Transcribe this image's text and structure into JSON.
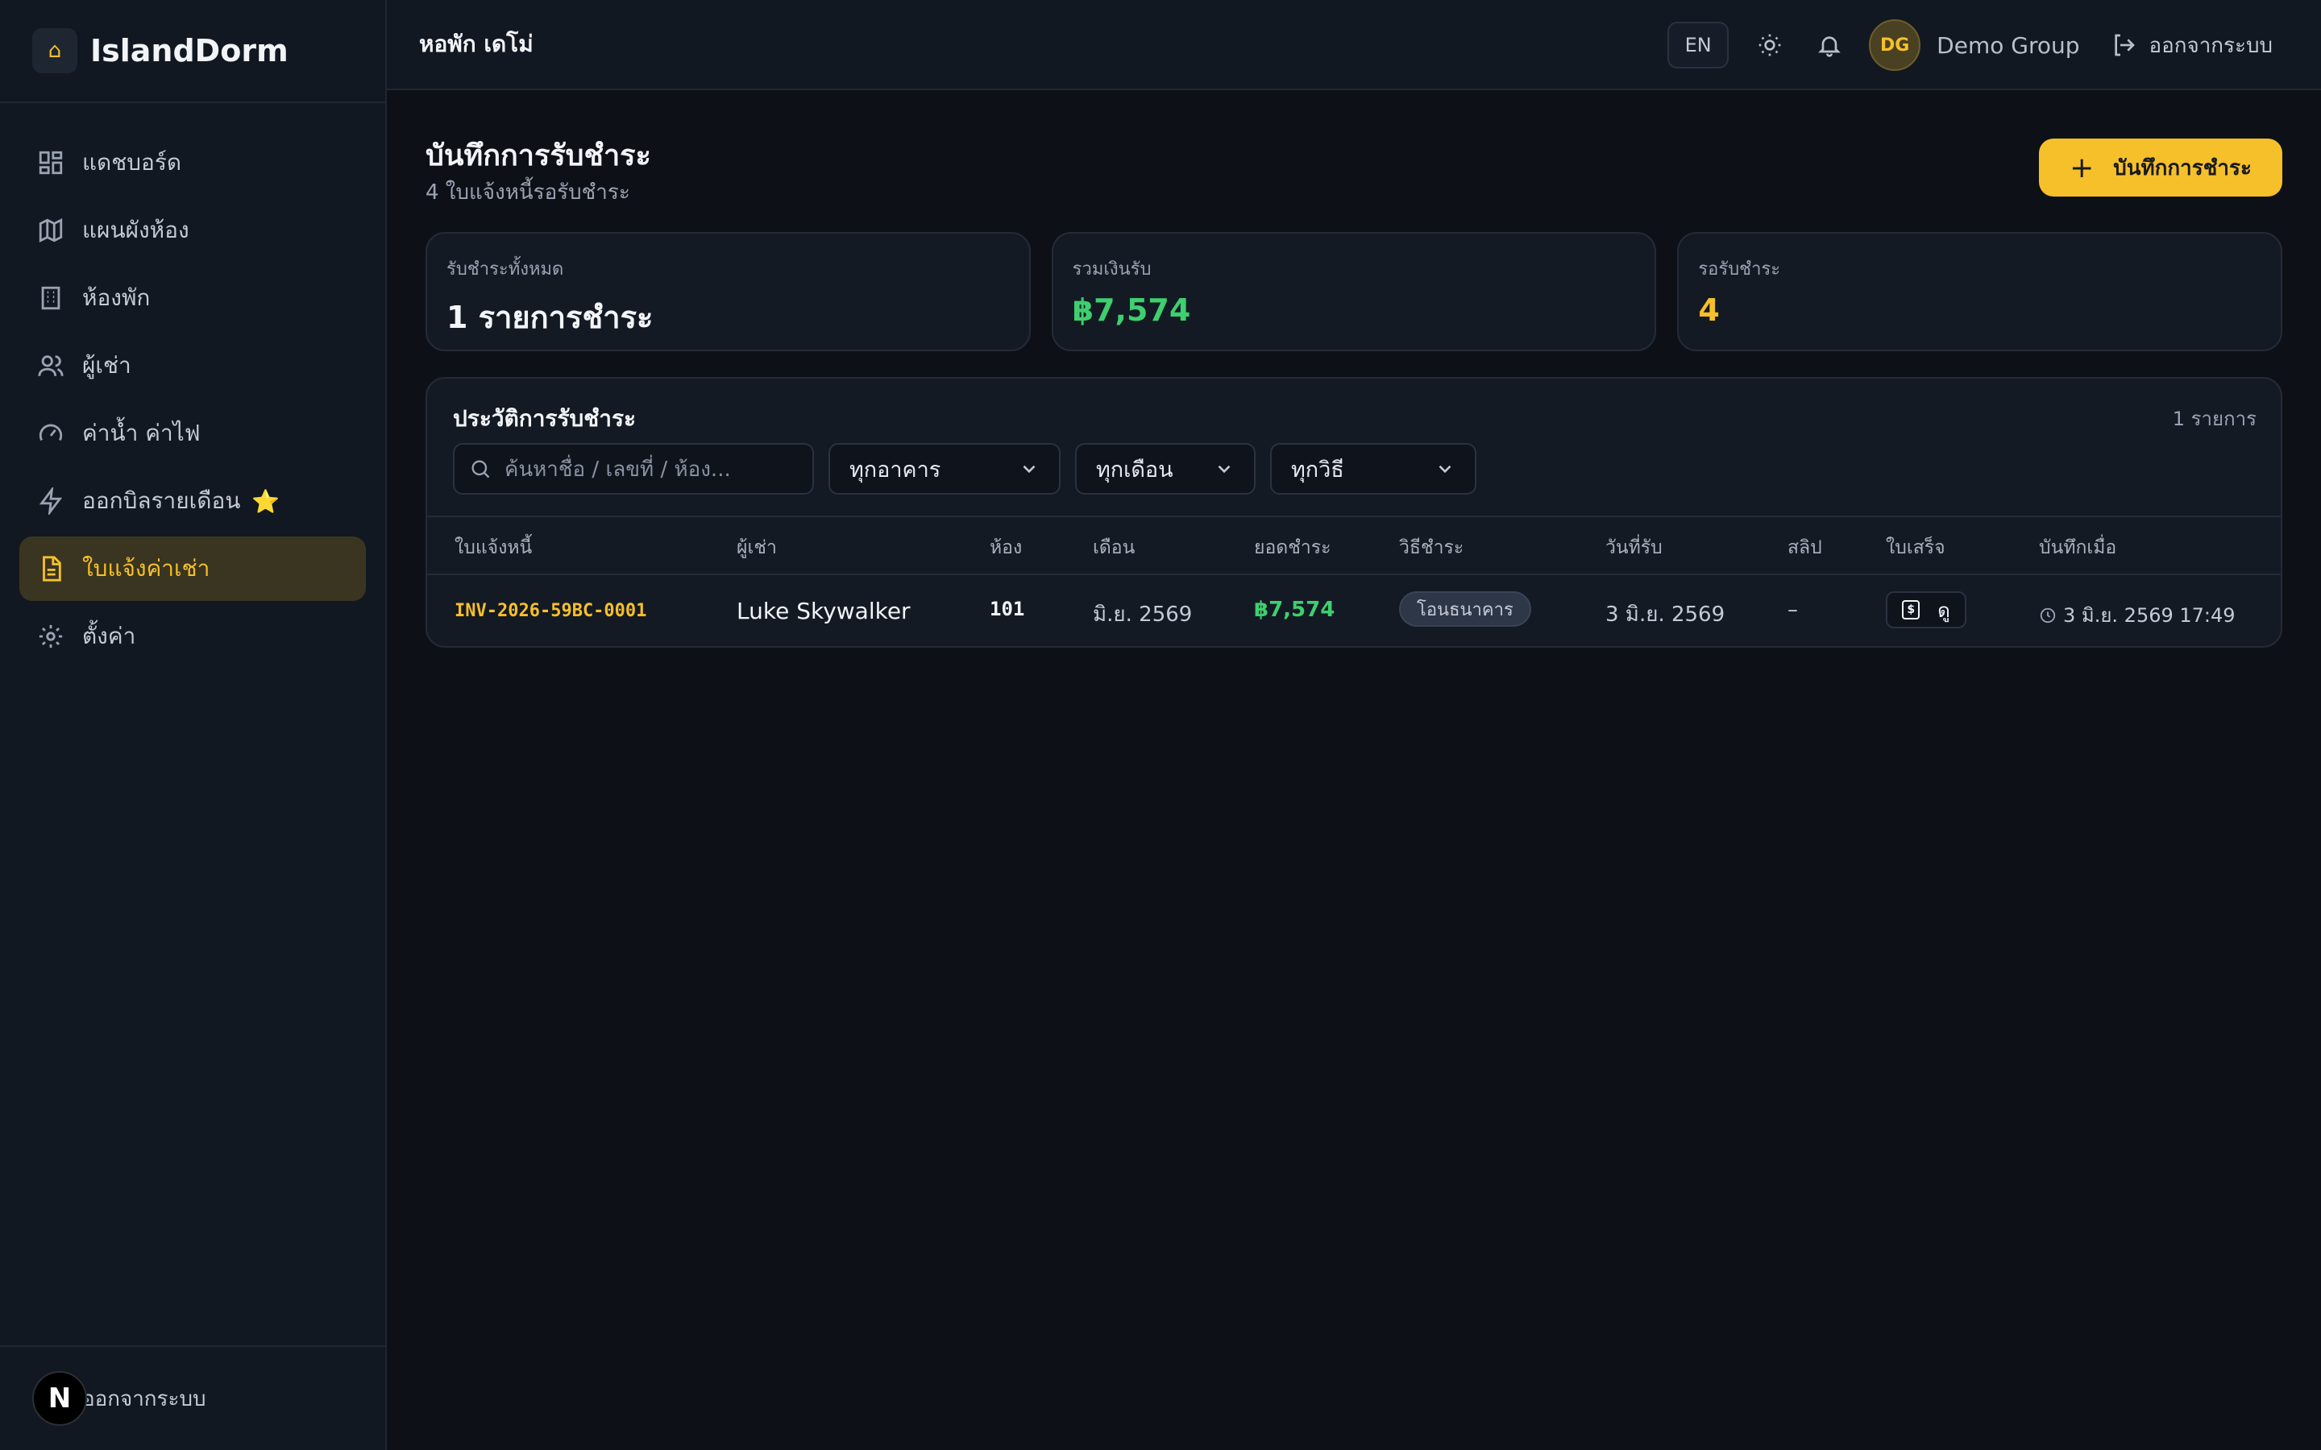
{
  "sidebar": {
    "brand": "IslandDorm",
    "brand_icon": "house-icon",
    "items": [
      {
        "label": "แดชบอร์ด",
        "icon": "dashboard-grid-icon"
      },
      {
        "label": "แผนผังห้อง",
        "icon": "map-icon"
      },
      {
        "label": "ห้องพัก",
        "icon": "building-icon"
      },
      {
        "label": "ผู้เช่า",
        "icon": "users-icon"
      },
      {
        "label": "ค่าน้ำ ค่าไฟ",
        "icon": "gauge-icon"
      },
      {
        "label": "ออกบิลรายเดือน",
        "icon": "lightning-icon",
        "emoji": "⭐"
      },
      {
        "label": "ใบแจ้งค่าเช่า",
        "icon": "document-icon",
        "active": true
      },
      {
        "label": "ตั้งค่า",
        "icon": "gear-icon"
      }
    ],
    "footer": {
      "badge": "N",
      "logout_label": "ออกจากระบบ"
    }
  },
  "header": {
    "title": "หอพัก เดโม่",
    "lang": "EN",
    "avatar_initials": "DG",
    "user_name": "Demo Group",
    "logout_label": "ออกจากระบบ"
  },
  "page": {
    "title": "บันทึกการรับชำระ",
    "subtitle": "4 ใบแจ้งหนี้รอรับชำระ",
    "primary_button": "บันทึกการชำระ"
  },
  "stats": [
    {
      "label": "รับชำระทั้งหมด",
      "value": "1 รายการชำระ",
      "color": "#f2f4f8"
    },
    {
      "label": "รวมเงินรับ",
      "value": "฿7,574",
      "color": "#3ecf6e"
    },
    {
      "label": "รอรับชำระ",
      "value": "4",
      "color": "#f6c02a"
    }
  ],
  "history": {
    "title": "ประวัติการรับชำระ",
    "count": "1 รายการ",
    "search_placeholder": "ค้นหาชื่อ / เลขที่ / ห้อง...",
    "filters": {
      "building": "ทุกอาคาร",
      "month": "ทุกเดือน",
      "method": "ทุกวิธี"
    },
    "columns": [
      "ใบแจ้งหนี้",
      "ผู้เช่า",
      "ห้อง",
      "เดือน",
      "ยอดชำระ",
      "วิธีชำระ",
      "วันที่รับ",
      "สลิป",
      "ใบเสร็จ",
      "บันทึกเมื่อ"
    ],
    "rows": [
      {
        "invoice": "INV-2026-59BC-0001",
        "tenant": "Luke Skywalker",
        "room": "101",
        "month": "มิ.ย. 2569",
        "amount": "฿7,574",
        "method": "โอนธนาคาร",
        "received_date": "3 มิ.ย. 2569",
        "slip": "–",
        "receipt_label": "ดู",
        "recorded_at": "3 มิ.ย. 2569 17:49"
      }
    ]
  },
  "colors": {
    "accent": "#f6c02a",
    "success": "#3ecf6e",
    "background": "#0d1117",
    "sidebar": "#121821"
  }
}
